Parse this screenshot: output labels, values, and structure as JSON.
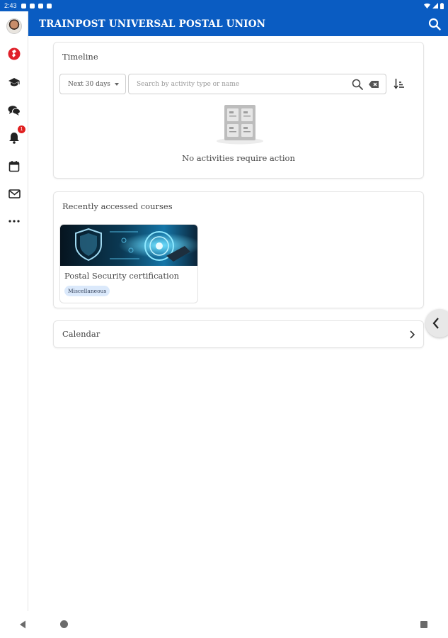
{
  "status_bar": {
    "time": "2:43"
  },
  "app_bar": {
    "title": "TRAINPOST UNIVERSAL POSTAL UNION"
  },
  "sidebar": {
    "notification_count": "1",
    "items": [
      {
        "icon": "user-avatar"
      },
      {
        "icon": "site-home-icon"
      },
      {
        "icon": "graduation-cap-icon"
      },
      {
        "icon": "messages-icon"
      },
      {
        "icon": "bell-icon"
      },
      {
        "icon": "calendar-icon"
      },
      {
        "icon": "mail-icon"
      },
      {
        "icon": "more-icon"
      }
    ]
  },
  "timeline": {
    "title": "Timeline",
    "filter_selected": "Next 30 days",
    "search_placeholder": "Search by activity type or name",
    "empty_message": "No activities require action"
  },
  "recent_courses": {
    "title": "Recently accessed courses",
    "courses": [
      {
        "name": "Postal Security certification",
        "category": "Miscellaneous"
      }
    ]
  },
  "calendar": {
    "title": "Calendar"
  },
  "colors": {
    "brand": "#0a5cc2",
    "badge": "#e02020",
    "tag_bg": "#dbe9fb"
  }
}
